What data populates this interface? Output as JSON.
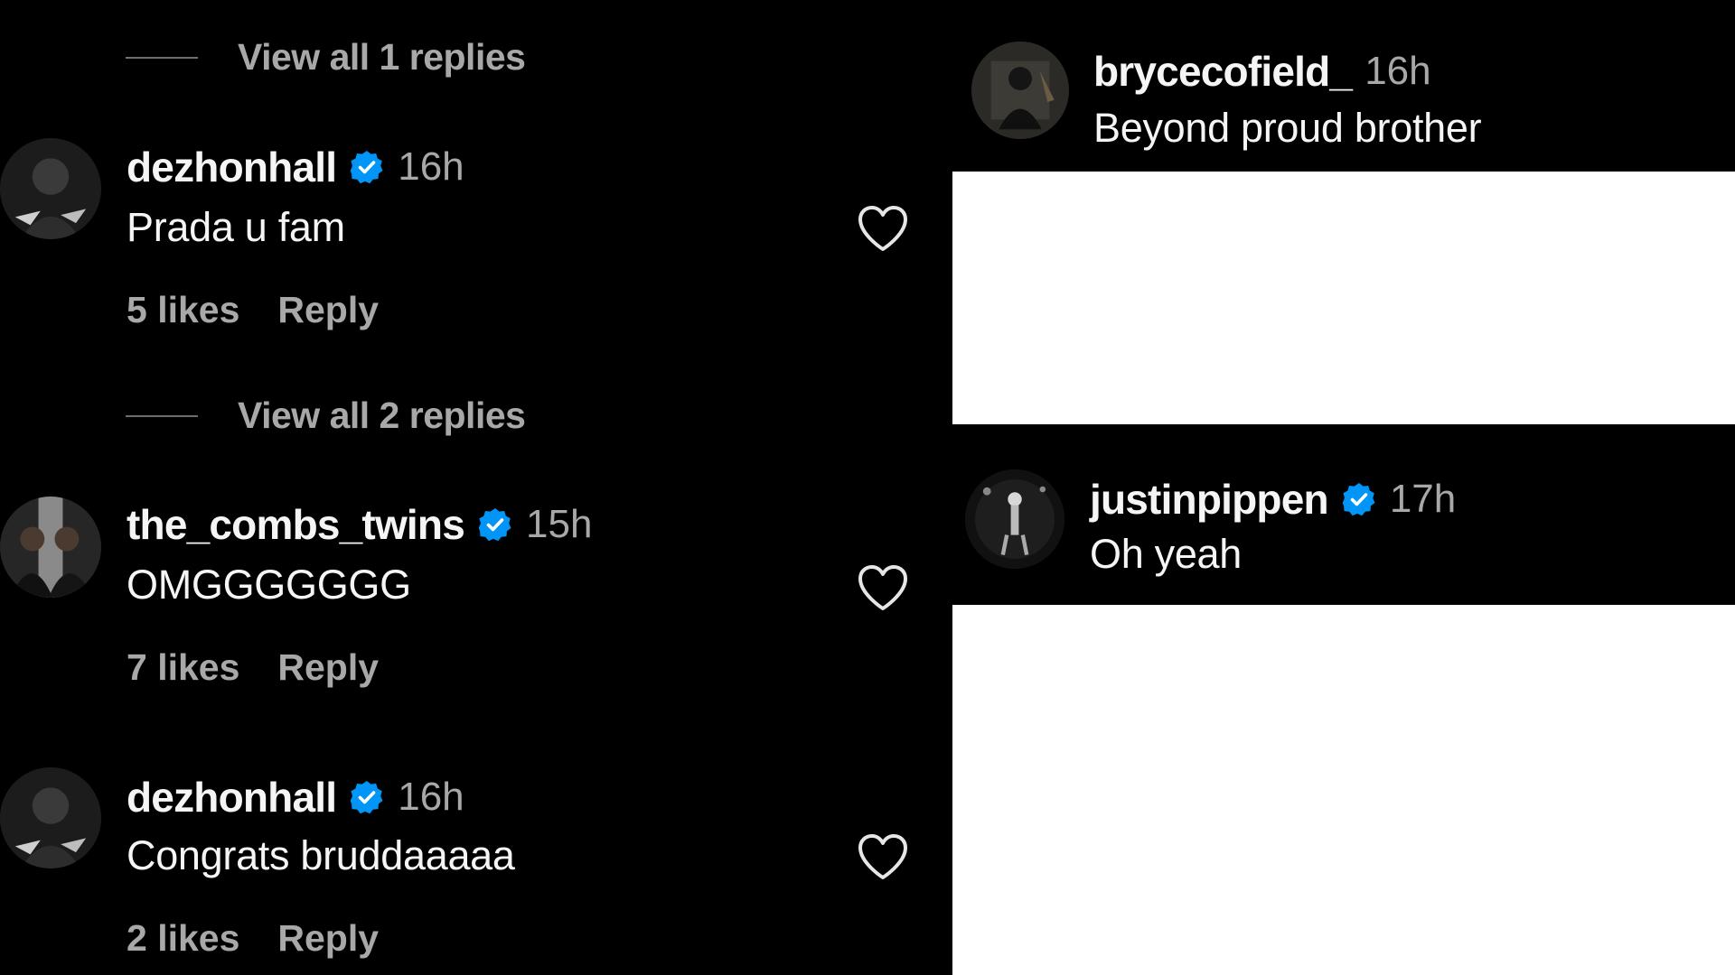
{
  "left": {
    "view_replies_1": "View all 1 replies",
    "view_replies_2": "View all 2 replies",
    "comments": [
      {
        "username": "dezhonhall",
        "time": "16h",
        "text": "Prada u fam",
        "likes": "5 likes",
        "reply": "Reply"
      },
      {
        "username": "the_combs_twins",
        "time": "15h",
        "text": "OMGGGGGGG",
        "likes": "7 likes",
        "reply": "Reply"
      },
      {
        "username": "dezhonhall",
        "time": "16h",
        "text": "Congrats bruddaaaaa",
        "likes": "2 likes",
        "reply": "Reply"
      }
    ]
  },
  "right": {
    "comments": [
      {
        "username": "brycecofield_",
        "time": "16h",
        "text": "Beyond proud brother"
      },
      {
        "username": "justinpippen",
        "time": "17h",
        "text": "Oh yeah"
      }
    ]
  },
  "colors": {
    "background": "#000000",
    "primary_text": "#f5f5f5",
    "secondary_text": "#a8a8a8",
    "verified_badge": "#0095f6"
  },
  "icons": {
    "verified": "verified-badge-icon",
    "like": "heart-outline-icon"
  }
}
